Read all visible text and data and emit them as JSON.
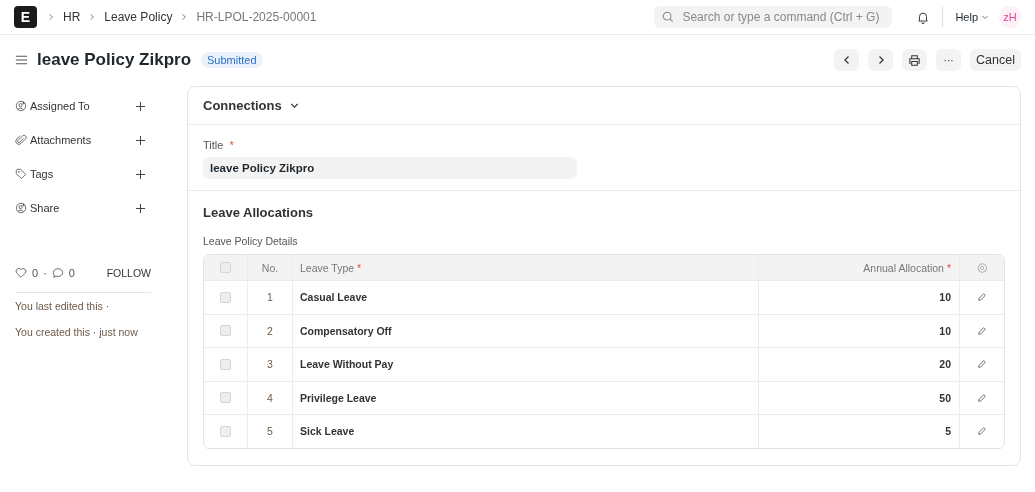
{
  "navbar": {
    "logo": "E",
    "breadcrumbs": [
      "HR",
      "Leave Policy",
      "HR-LPOL-2025-00001"
    ],
    "search": {
      "placeholder": "Search or type a command (Ctrl + G)"
    },
    "help": "Help",
    "avatar": "zH"
  },
  "page_header": {
    "title": "leave Policy Zikpro",
    "status": "Submitted",
    "cancel": "Cancel",
    "more": "···"
  },
  "sidebar": {
    "items": [
      {
        "label": "Assigned To",
        "kind": "user"
      },
      {
        "label": "Attachments",
        "kind": "clip"
      },
      {
        "label": "Tags",
        "kind": "tag"
      },
      {
        "label": "Share",
        "kind": "user"
      }
    ],
    "likes": "0",
    "separator": "·",
    "comments": "0",
    "follow": "FOLLOW",
    "activity": [
      "You last edited this ·",
      "You created this · just now"
    ]
  },
  "connections": {
    "label": "Connections",
    "expanded": false
  },
  "title_field": {
    "label": "Title",
    "required_mark": "*",
    "value": "leave Policy Zikpro"
  },
  "section": {
    "heading": "Leave Allocations",
    "table_label": "Leave Policy Details"
  },
  "table": {
    "header_checked": false,
    "columns": [
      {
        "label": "No."
      },
      {
        "label": "Leave Type",
        "required_mark": "*"
      },
      {
        "label": "Annual Allocation",
        "required_mark": "*"
      }
    ],
    "rows": [
      {
        "no": "1",
        "leave_type": "Casual Leave",
        "allocation": "10",
        "checked": false
      },
      {
        "no": "2",
        "leave_type": "Compensatory Off",
        "allocation": "10",
        "checked": false
      },
      {
        "no": "3",
        "leave_type": "Leave Without Pay",
        "allocation": "20",
        "checked": false
      },
      {
        "no": "4",
        "leave_type": "Privilege Leave",
        "allocation": "50",
        "checked": false
      },
      {
        "no": "5",
        "leave_type": "Sick Leave",
        "allocation": "5",
        "checked": false
      }
    ]
  }
}
